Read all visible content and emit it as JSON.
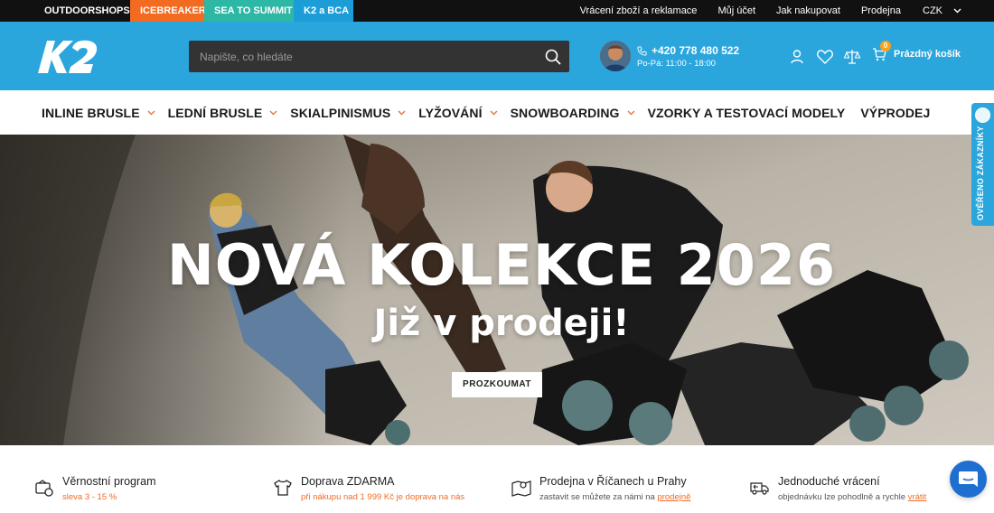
{
  "topbar": {
    "brands": [
      {
        "label": "OUTDOORSHOPS",
        "color": "#111111"
      },
      {
        "label": "ICEBREAKER",
        "color": "#f36b21"
      },
      {
        "label": "SEA TO SUMMIT",
        "color": "#2db7a5"
      },
      {
        "label": "K2 a BCA",
        "color": "#1b9ed8"
      }
    ],
    "links": [
      "Vrácení zboží a reklamace",
      "Můj účet",
      "Jak nakupovat",
      "Prodejna"
    ],
    "currency": "CZK"
  },
  "header": {
    "search_placeholder": "Napište, co hledáte",
    "phone": "+420 778 480 522",
    "hours": "Po-Pá: 11:00 - 18:00",
    "cart_count": "0",
    "cart_label": "Prázdný košík",
    "accent_color": "#2aa6dd"
  },
  "nav": {
    "items": [
      {
        "label": "INLINE BRUSLE",
        "dropdown": true
      },
      {
        "label": "LEDNÍ BRUSLE",
        "dropdown": true
      },
      {
        "label": "SKIALPINISMUS",
        "dropdown": true
      },
      {
        "label": "LYŽOVÁNÍ",
        "dropdown": true
      },
      {
        "label": "SNOWBOARDING",
        "dropdown": true
      },
      {
        "label": "VZORKY A TESTOVACÍ MODELY",
        "dropdown": false
      },
      {
        "label": "VÝPRODEJ",
        "dropdown": false
      }
    ]
  },
  "hero": {
    "title": "NOVÁ KOLEKCE 2026",
    "subtitle": "Již v prodeji!",
    "button": "PROZKOUMAT"
  },
  "verified_tab": {
    "label": "OVĚŘENO ZÁKAZNÍKY"
  },
  "benefits": [
    {
      "icon": "loyalty-icon",
      "title": "Věrnostní program",
      "sub": "sleva 3 - 15 %",
      "link": ""
    },
    {
      "icon": "tshirt-icon",
      "title": "Doprava ZDARMA",
      "sub": "při nákupu nad 1 999 Kč je doprava na nás",
      "link": ""
    },
    {
      "icon": "map-pin-icon",
      "title": "Prodejna v Říčanech u Prahy",
      "sub": "zastavit se můžete za námi na",
      "link": "prodejně"
    },
    {
      "icon": "return-truck-icon",
      "title": "Jednoduché vrácení",
      "sub": "objednávku lze pohodlně a rychle",
      "link": "vrátit"
    }
  ]
}
